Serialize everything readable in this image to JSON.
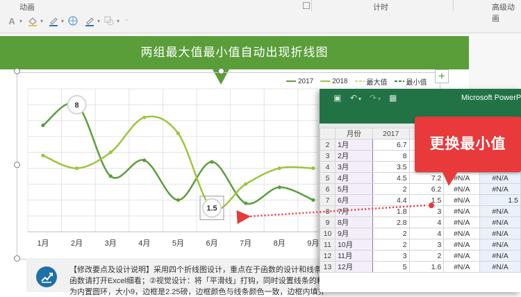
{
  "ribbon": {
    "groups": [
      "动画",
      "计时",
      "高级动画"
    ]
  },
  "slide": {
    "title": "两组最大值最小值自动出现折线图",
    "plus_label": "+"
  },
  "legend": [
    {
      "name": "2017",
      "color": "#5a9e3a",
      "style": "solid-marker"
    },
    {
      "name": "2018",
      "color": "#9bc53d",
      "style": "solid-marker"
    },
    {
      "name": "最大值",
      "color": "#c9d86a",
      "style": "dashed"
    },
    {
      "name": "最小值",
      "color": "#3f7f3a",
      "style": "dashed"
    }
  ],
  "chart_data": {
    "type": "line",
    "categories": [
      "1月",
      "2月",
      "3月",
      "4月",
      "5月",
      "6月",
      "7月",
      "8月",
      "9月"
    ],
    "series": [
      {
        "name": "2017",
        "color": "#5a9e3a",
        "values": [
          6.7,
          8,
          3.5,
          4.5,
          2,
          4.4,
          1.8,
          2.8,
          2
        ]
      },
      {
        "name": "2018",
        "color": "#9bc53d",
        "values": [
          4.8,
          4.0,
          5.0,
          7.2,
          6.2,
          1.5,
          3.0,
          4.0,
          4.0
        ]
      }
    ],
    "annotations": [
      {
        "category": "2月",
        "label": "8"
      },
      {
        "category": "6月",
        "label": "1.5"
      }
    ],
    "ylim": [
      0,
      9
    ],
    "grid": true
  },
  "excel": {
    "title": "Microsoft PowerPo",
    "col_headers": [
      "",
      "月份",
      "2017",
      "",
      "",
      ""
    ],
    "rows": [
      {
        "n": "2",
        "a": "1月",
        "b": "6.7",
        "c": "",
        "d": "",
        "e": ""
      },
      {
        "n": "3",
        "a": "2月",
        "b": "8",
        "c": "",
        "d": "",
        "e": ""
      },
      {
        "n": "4",
        "a": "3月",
        "b": "3.5",
        "c": "",
        "d": "",
        "e": ""
      },
      {
        "n": "5",
        "a": "4月",
        "b": "4.5",
        "c": "7.2",
        "d": "#N/A",
        "e": "#N/A"
      },
      {
        "n": "6",
        "a": "5月",
        "b": "2",
        "c": "6.2",
        "d": "#N/A",
        "e": "#N/A"
      },
      {
        "n": "7",
        "a": "6月",
        "b": "4.4",
        "c": "1.5",
        "d": "#N/A",
        "e": "1.5"
      },
      {
        "n": "8",
        "a": "7月",
        "b": "1.8",
        "c": "3",
        "d": "#N/A",
        "e": "#N/A"
      },
      {
        "n": "9",
        "a": "8月",
        "b": "2.8",
        "c": "4",
        "d": "#N/A",
        "e": "#N/A"
      },
      {
        "n": "10",
        "a": "9月",
        "b": "2",
        "c": "4",
        "d": "#N/A",
        "e": "#N/A"
      },
      {
        "n": "11",
        "a": "10月",
        "b": "2",
        "c": "3",
        "d": "#N/A",
        "e": "#N/A"
      },
      {
        "n": "12",
        "a": "11月",
        "b": "3",
        "c": "2",
        "d": "#N/A",
        "e": "#N/A"
      },
      {
        "n": "13",
        "a": "12月",
        "b": "5",
        "c": "1.6",
        "d": "#N/A",
        "e": "#N/A"
      }
    ]
  },
  "callout": {
    "text": "更换最小值"
  },
  "description": {
    "line1": "【修改要点及设计说明】采用四个折线图设计，重点在于函数的设计和线条、标",
    "line2": "函数请打开Excel细看；②视觉设计：将「平滑线」打钩，同时设置线条的粗细",
    "line3": "为内置圆环，大小9，边框是2.25磅，边框颜色与线条颜色一致，边框内填充为"
  },
  "colors": {
    "brand_green": "#5a9e3a",
    "excel_green": "#217346",
    "callout_red": "#e8393b"
  }
}
